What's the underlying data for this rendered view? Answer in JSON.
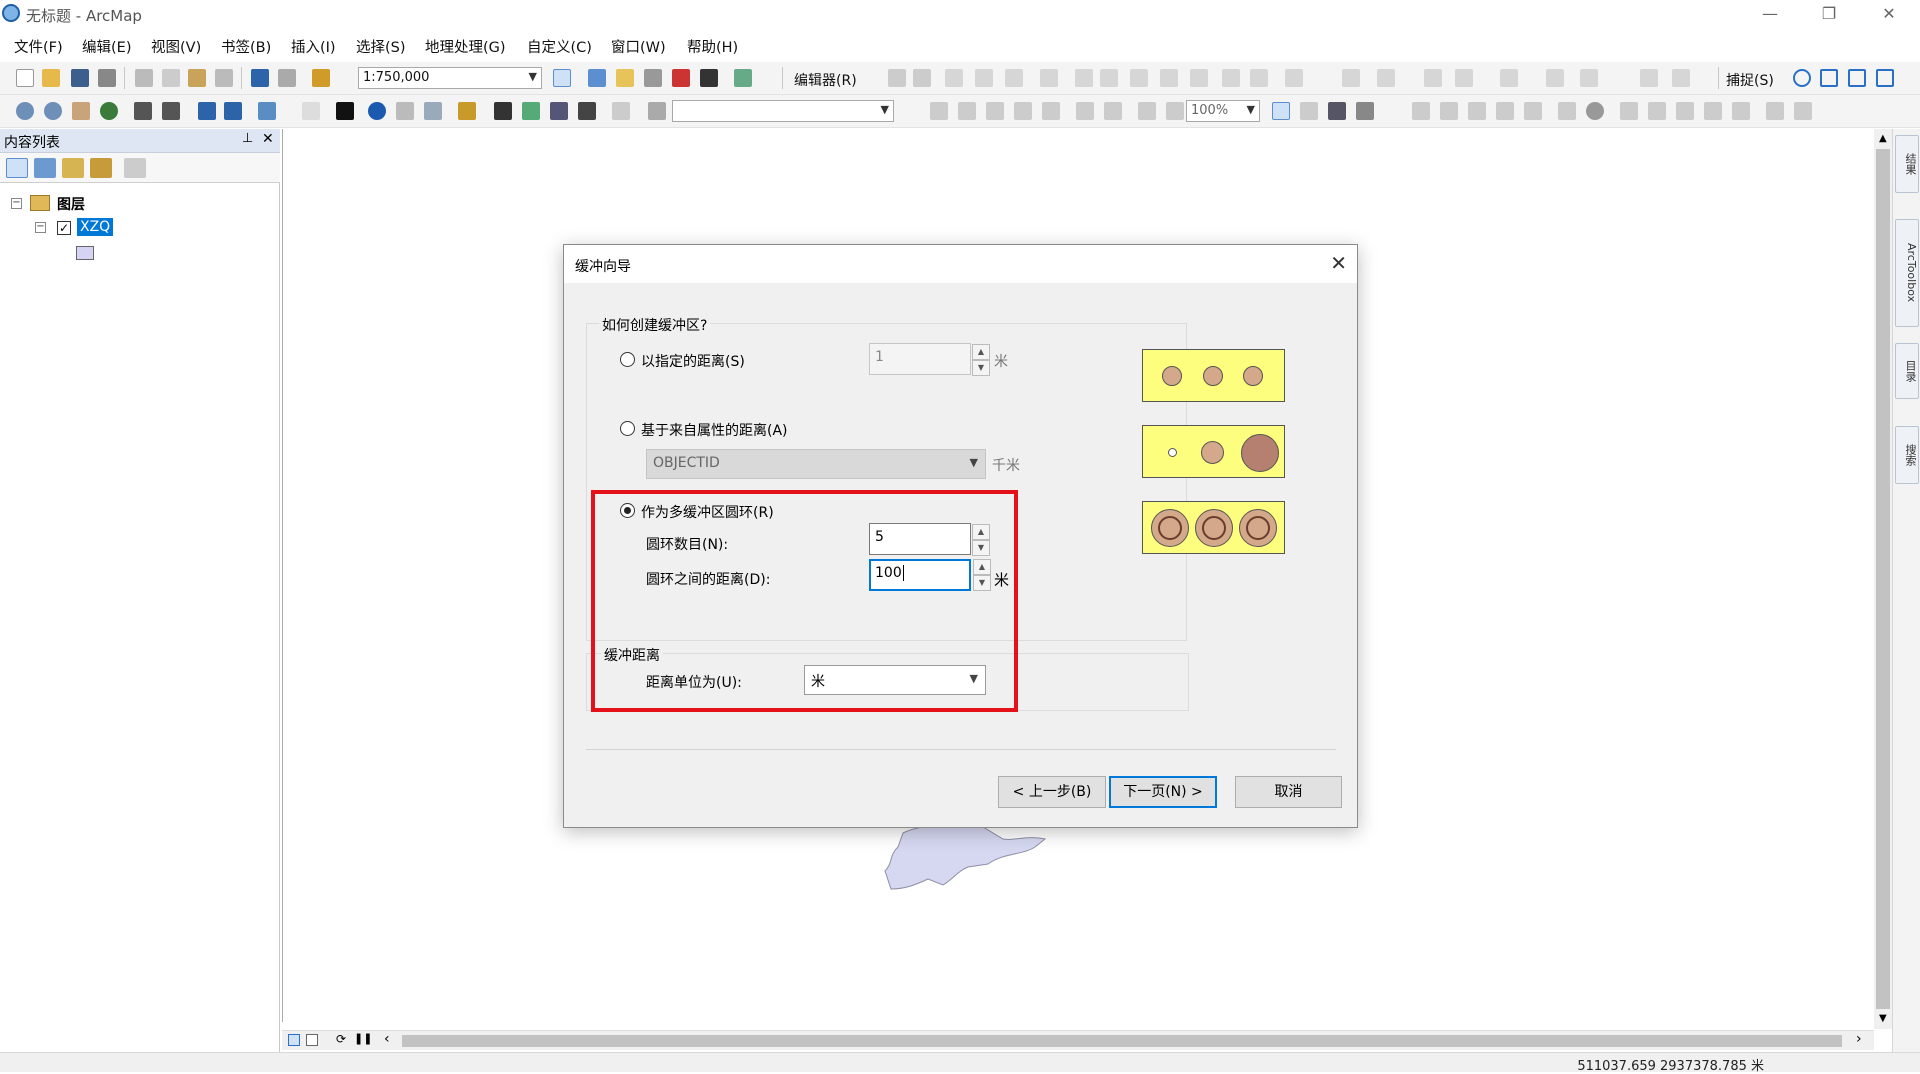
{
  "window": {
    "title": "无标题 - ArcMap"
  },
  "menu": [
    "文件(F)",
    "编辑(E)",
    "视图(V)",
    "书签(B)",
    "插入(I)",
    "选择(S)",
    "地理处理(G)",
    "自定义(C)",
    "窗口(W)",
    "帮助(H)"
  ],
  "toolbar": {
    "scale": "1:750,000",
    "editor_label": "编辑器(R)",
    "snapping_label": "捕捉(S)",
    "zoom_percent": "100%"
  },
  "toc": {
    "header": "内容列表",
    "layers_label": "图层",
    "layer_name": "XZQ"
  },
  "right_dock": [
    "结果",
    "ArcToolbox",
    "目录",
    "搜索"
  ],
  "status": {
    "coordinates": "511037.659  2937378.785 米"
  },
  "dialog": {
    "title": "缓冲向导",
    "group_title": "如何创建缓冲区?",
    "option_specified": "以指定的距离(S)",
    "specified_value": "1",
    "specified_unit": "米",
    "option_attribute": "基于来自属性的距离(A)",
    "attribute_field": "OBJECTID",
    "attribute_unit": "千米",
    "option_multiring": "作为多缓冲区圆环(R)",
    "rings_label": "圆环数目(N):",
    "rings_value": "5",
    "distance_label": "圆环之间的距离(D):",
    "distance_value": "100",
    "distance_unit": "米",
    "buffer_group_title": "缓冲距离",
    "units_label": "距离单位为(U):",
    "units_value": "米",
    "back_button": "< 上一步(B)",
    "next_button": "下一页(N) >",
    "cancel_button": "取消",
    "selected_option": "multiring"
  },
  "colors": {
    "highlight": "#e4111b",
    "selection": "#0078d7",
    "preview_fill": "#fefe7e"
  }
}
